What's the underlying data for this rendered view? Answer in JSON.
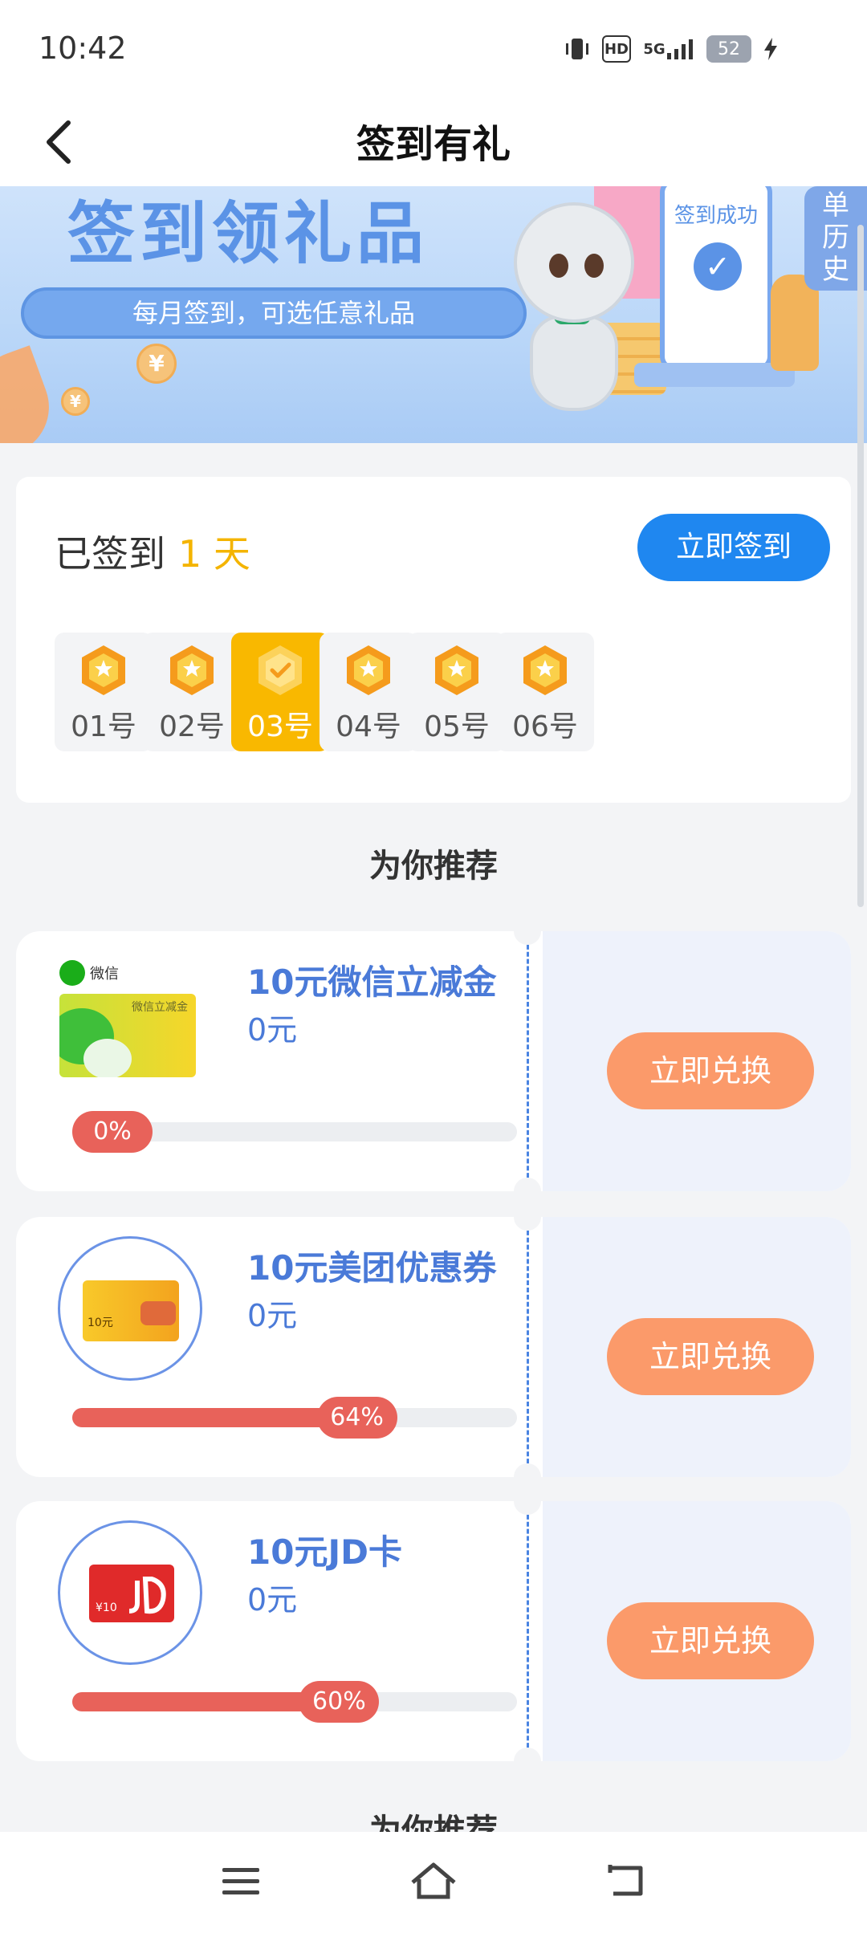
{
  "status": {
    "time": "10:42",
    "hd": "HD",
    "network": "5G",
    "battery": "52"
  },
  "header": {
    "title": "签到有礼"
  },
  "banner": {
    "title": "签到领礼品",
    "subtitle": "每月签到，可选任意礼品",
    "phone_text": "签到成功",
    "history_tab": "单\n历\n史",
    "coin_symbol": "¥"
  },
  "signin": {
    "signed_prefix": "已签到",
    "signed_days": "1 天",
    "button_label": "立即签到",
    "days": [
      {
        "label": "01号",
        "active": false
      },
      {
        "label": "02号",
        "active": false
      },
      {
        "label": "03号",
        "active": true
      },
      {
        "label": "04号",
        "active": false
      },
      {
        "label": "05号",
        "active": false
      },
      {
        "label": "06号",
        "active": false
      }
    ]
  },
  "recommend": {
    "heading": "为你推荐"
  },
  "coupons": [
    {
      "name": "10元微信立减金",
      "price": "0元",
      "progress": "0%",
      "progress_value": 0,
      "button": "立即兑换",
      "brand": "微信",
      "card_label": "微信立减金"
    },
    {
      "name": "10元美团优惠券",
      "price": "0元",
      "progress": "64%",
      "progress_value": 64,
      "button": "立即兑换",
      "card_label": "10元"
    },
    {
      "name": "10元JD卡",
      "price": "0元",
      "progress": "60%",
      "progress_value": 60,
      "button": "立即兑换",
      "card_label": "¥10"
    }
  ],
  "colors": {
    "accent": "#1f87f0",
    "gold": "#f9b800",
    "coupon_text": "#4a7ad8",
    "progress": "#e8625a",
    "redeem": "#fb9a6a"
  },
  "icons": {
    "back": "chevron-left-icon",
    "menu": "menu-icon",
    "home": "home-icon",
    "back_nav": "return-icon"
  }
}
